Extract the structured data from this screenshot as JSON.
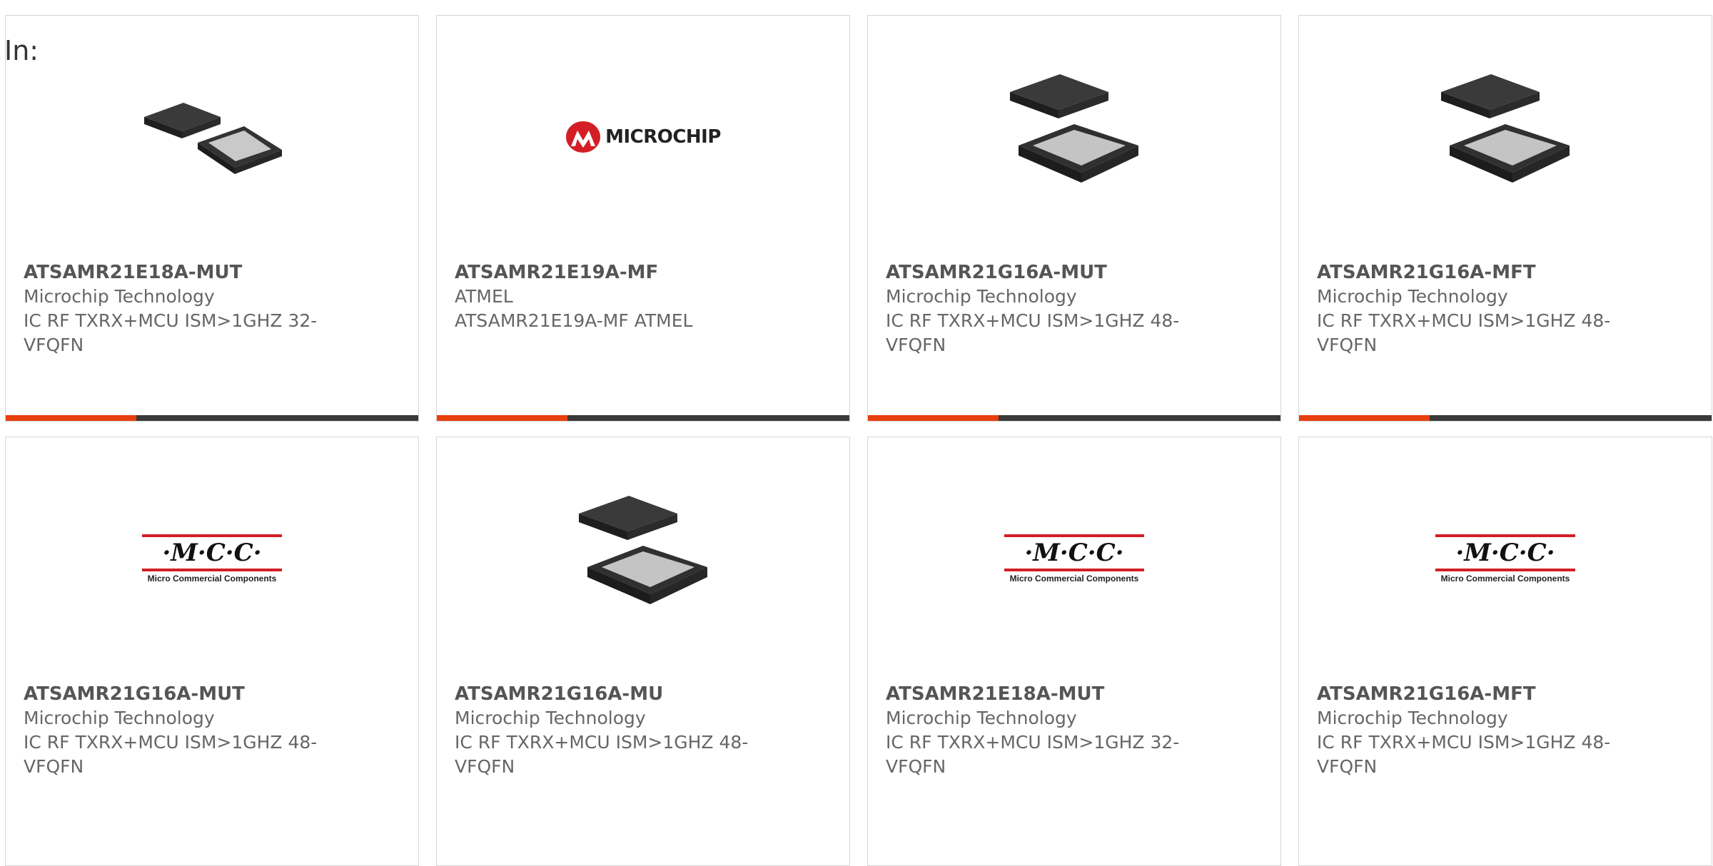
{
  "header": {
    "label": "In:"
  },
  "colors": {
    "accent": "#e8400c",
    "bar": "#3a3a3a",
    "logo_red": "#d31e25"
  },
  "logos": {
    "microchip_word": "MICROCHIP",
    "mcc_big": "·M·C·C·",
    "mcc_small": "Micro Commercial Components"
  },
  "cards": [
    {
      "part": "ATSAMR21E18A-MUT",
      "manufacturer": "Microchip Technology",
      "description": "IC RF TXRX+MCU ISM>1GHZ 32-VFQFN",
      "image": "chip-package-small"
    },
    {
      "part": "ATSAMR21E19A-MF",
      "manufacturer": "ATMEL",
      "description": "ATSAMR21E19A-MF ATMEL",
      "image": "microchip-logo"
    },
    {
      "part": "ATSAMR21G16A-MUT",
      "manufacturer": "Microchip Technology",
      "description": "IC RF TXRX+MCU ISM>1GHZ 48-VFQFN",
      "image": "chip-package"
    },
    {
      "part": "ATSAMR21G16A-MFT",
      "manufacturer": "Microchip Technology",
      "description": "IC RF TXRX+MCU ISM>1GHZ 48-VFQFN",
      "image": "chip-package"
    },
    {
      "part": "ATSAMR21G16A-MUT",
      "manufacturer": "Microchip Technology",
      "description": "IC RF TXRX+MCU ISM>1GHZ 48-VFQFN",
      "image": "mcc-logo"
    },
    {
      "part": "ATSAMR21G16A-MU",
      "manufacturer": "Microchip Technology",
      "description": "IC RF TXRX+MCU ISM>1GHZ 48-VFQFN",
      "image": "chip-package"
    },
    {
      "part": "ATSAMR21E18A-MUT",
      "manufacturer": "Microchip Technology",
      "description": "IC RF TXRX+MCU ISM>1GHZ 32-VFQFN",
      "image": "mcc-logo"
    },
    {
      "part": "ATSAMR21G16A-MFT",
      "manufacturer": "Microchip Technology",
      "description": "IC RF TXRX+MCU ISM>1GHZ 48-VFQFN",
      "image": "mcc-logo"
    }
  ]
}
